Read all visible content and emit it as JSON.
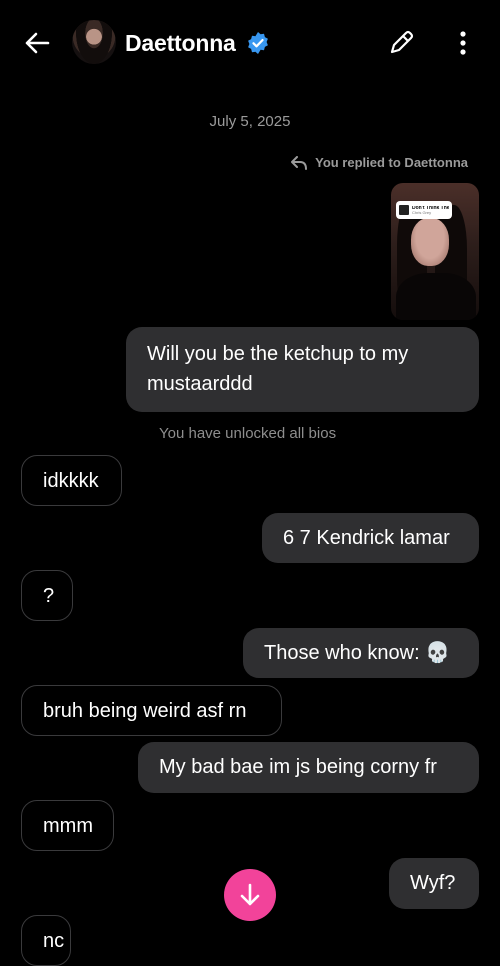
{
  "header": {
    "contact_name": "Daettonna",
    "icons": [
      "back-arrow-icon",
      "avatar",
      "verified-badge-icon",
      "edit-icon",
      "more-vertical-icon"
    ]
  },
  "thread": {
    "date": "July 5, 2025",
    "replied_notice": "You replied to Daettonna",
    "story_music": {
      "song": "Don't Think They K...",
      "artist": "Chris Grey"
    },
    "system_notice": "You have unlocked all bios",
    "messages": [
      {
        "side": "out",
        "text": "Will you be the ketchup to my\nmustaarddd"
      },
      {
        "side": "in",
        "text": "idkkkk"
      },
      {
        "side": "out",
        "text": "6 7 Kendrick lamar"
      },
      {
        "side": "in",
        "text": "?"
      },
      {
        "side": "out",
        "text": "Those who know: 💀"
      },
      {
        "side": "in",
        "text": "bruh being weird asf rn"
      },
      {
        "side": "out",
        "text": "My bad bae im js being corny fr"
      },
      {
        "side": "in",
        "text": "mmm"
      },
      {
        "side": "out",
        "text": "Wyf?"
      },
      {
        "side": "in",
        "text": "nc"
      }
    ]
  },
  "colors": {
    "accent": "#f2439a",
    "verified": "#3897f0",
    "outgoing_bubble": "#2f2f31",
    "background": "#000000"
  }
}
